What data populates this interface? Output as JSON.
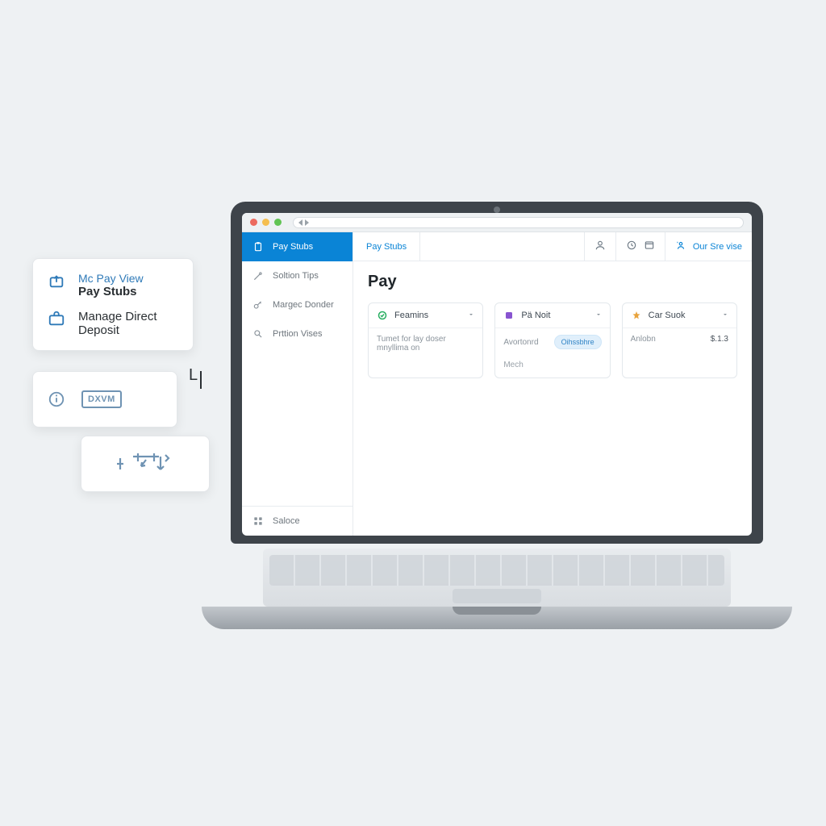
{
  "floating": {
    "card1": {
      "title": "Mc Pay View",
      "subtitle": "Pay Stubs",
      "item2": "Manage Direct Deposit"
    },
    "mid_label": "DXVM",
    "letter": "L"
  },
  "browser": {},
  "sidebar": {
    "items": [
      {
        "label": "Pay Stubs"
      },
      {
        "label": "Soltion Tips"
      },
      {
        "label": "Margec Donder"
      },
      {
        "label": "Prttion Vises"
      }
    ],
    "footer": {
      "label": "Saloce"
    }
  },
  "topbar": {
    "crumb": "Pay Stubs",
    "service": "Our Sre vise"
  },
  "page": {
    "title": "Pay",
    "cards": [
      {
        "title": "Feamins",
        "body": "Tumet for lay doser mnyllima on",
        "body2": "",
        "action": "",
        "amount": ""
      },
      {
        "title": "Pä Noit",
        "body": "Avortonrd",
        "body2": "Mech",
        "action": "Oihssbhre",
        "amount": ""
      },
      {
        "title": "Car Suok",
        "body": "Anlobn",
        "body2": "",
        "action": "",
        "amount": "$.1.3"
      }
    ]
  }
}
